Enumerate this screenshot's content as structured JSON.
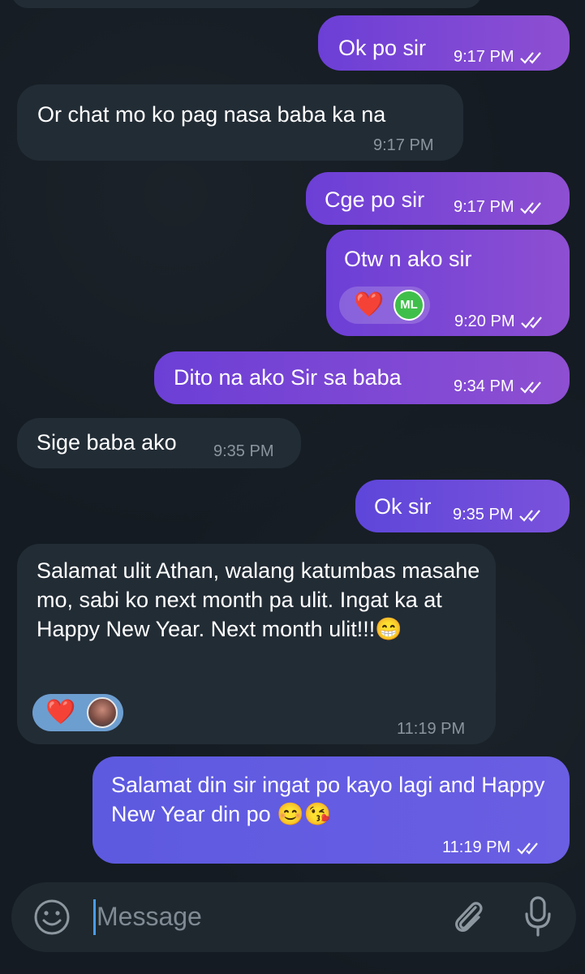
{
  "messages": [
    {
      "text": "Ok po sir",
      "time": "9:17 PM"
    },
    {
      "text": "Or chat mo ko pag nasa baba ka na",
      "time": "9:17 PM"
    },
    {
      "text": "Cge po sir",
      "time": "9:17 PM"
    },
    {
      "text": "Otw n ako sir",
      "time": "9:20 PM",
      "reaction": "❤️",
      "reactor_initials": "ML"
    },
    {
      "text": "Dito na ako Sir sa baba",
      "time": "9:34 PM"
    },
    {
      "text": "Sige baba ako",
      "time": "9:35 PM"
    },
    {
      "text": "Ok sir",
      "time": "9:35 PM"
    },
    {
      "text": "Salamat ulit Athan, walang katumbas masahe mo, sabi ko next month pa ulit. Ingat ka at Happy New Year. Next month ulit!!!😁",
      "time": "11:19 PM",
      "reaction": "❤️"
    },
    {
      "text": "Salamat din sir ingat po kayo lagi and Happy New Year din po 😊😘",
      "time": "11:19 PM"
    }
  ],
  "composer": {
    "placeholder": "Message"
  },
  "colors": {
    "outgoing": "#7b4bd6",
    "incoming": "#222c35",
    "background": "#141b22",
    "heart": "#e02626"
  }
}
